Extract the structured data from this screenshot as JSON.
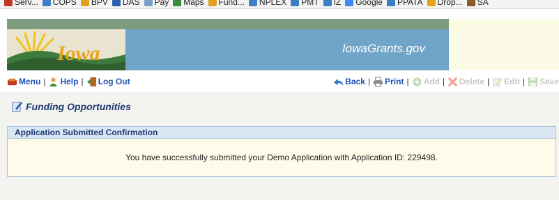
{
  "bookmarks": [
    {
      "label": "Serv...",
      "icon": "service-icon",
      "color": "#c0392b"
    },
    {
      "label": "COPS",
      "icon": "ie-page-icon",
      "color": "#3d7fc4"
    },
    {
      "label": "BPV",
      "icon": "globe-icon",
      "color": "#e2a21f"
    },
    {
      "label": "DAS",
      "icon": "das-icon",
      "color": "#2b5fb0"
    },
    {
      "label": "Pay",
      "icon": "pay-icon",
      "color": "#7aa0c8"
    },
    {
      "label": "Maps",
      "icon": "maps-icon",
      "color": "#3a8e3a"
    },
    {
      "label": "Fund...",
      "icon": "globe-icon",
      "color": "#e2a21f"
    },
    {
      "label": "NPLEX",
      "icon": "ie-page-icon",
      "color": "#3d7fc4"
    },
    {
      "label": "PMT",
      "icon": "ie-page-icon",
      "color": "#3d7fc4"
    },
    {
      "label": "IZ",
      "icon": "ie-page-icon",
      "color": "#3d7fc4"
    },
    {
      "label": "Google",
      "icon": "google-icon",
      "color": "#4285f4"
    },
    {
      "label": "PPATA",
      "icon": "ie-page-icon",
      "color": "#3d7fc4"
    },
    {
      "label": "Drop...",
      "icon": "globe-icon",
      "color": "#e2a21f"
    },
    {
      "label": "SA",
      "icon": "sa-icon",
      "color": "#8a5a2b"
    }
  ],
  "banner": {
    "logo_text": "Iowa",
    "site_title": "IowaGrants.gov"
  },
  "toolbar": {
    "menu": "Menu",
    "help": "Help",
    "logout": "Log Out",
    "back": "Back",
    "print": "Print",
    "add": "Add",
    "delete": "Delete",
    "edit": "Edit",
    "save": "Save",
    "separator": "|"
  },
  "page": {
    "title": "Funding Opportunities"
  },
  "panel": {
    "header": "Application Submitted Confirmation",
    "message": "You have successfully submitted your Demo Application with Application ID: 229498."
  }
}
